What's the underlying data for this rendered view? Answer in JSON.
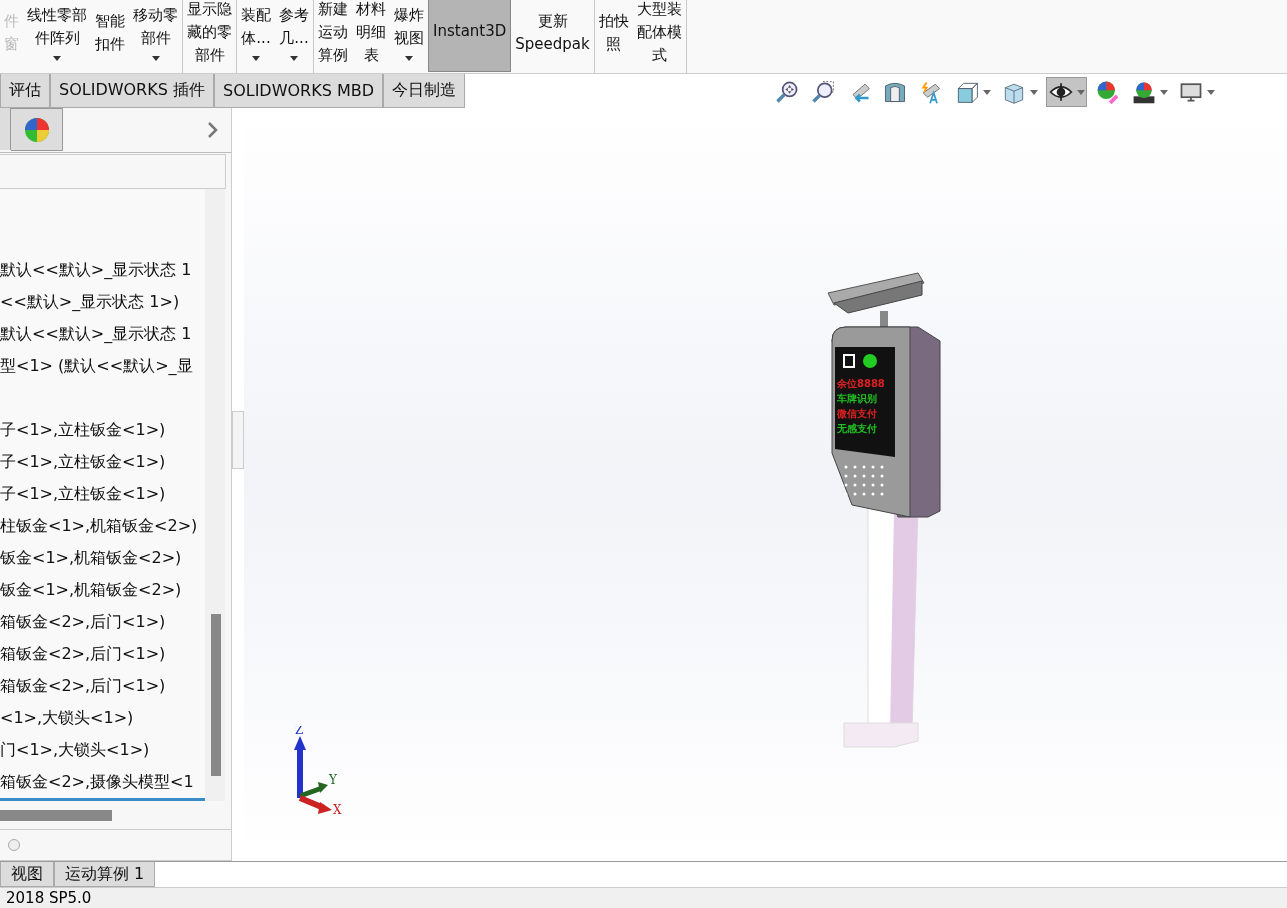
{
  "toolbar": {
    "items": [
      {
        "lines": [
          "件",
          "窗"
        ],
        "caret": false,
        "selected": false,
        "disabled": true,
        "group_end": false
      },
      {
        "lines": [
          "线性零部",
          "件阵列"
        ],
        "caret": true,
        "selected": false,
        "disabled": false,
        "group_end": false
      },
      {
        "lines": [
          "智能",
          "扣件"
        ],
        "caret": false,
        "selected": false,
        "disabled": false,
        "group_end": false
      },
      {
        "lines": [
          "移动零",
          "部件"
        ],
        "caret": true,
        "selected": false,
        "disabled": false,
        "group_end": true
      },
      {
        "lines": [
          "显示隐",
          "藏的零",
          "部件"
        ],
        "caret": false,
        "selected": false,
        "disabled": false,
        "group_end": true
      },
      {
        "lines": [
          "装配",
          "体..."
        ],
        "caret": true,
        "selected": false,
        "disabled": false,
        "group_end": false
      },
      {
        "lines": [
          "参考",
          "几..."
        ],
        "caret": true,
        "selected": false,
        "disabled": false,
        "group_end": true
      },
      {
        "lines": [
          "新建",
          "运动",
          "算例"
        ],
        "caret": false,
        "selected": false,
        "disabled": false,
        "group_end": false
      },
      {
        "lines": [
          "材料",
          "明细",
          "表"
        ],
        "caret": false,
        "selected": false,
        "disabled": false,
        "group_end": false
      },
      {
        "lines": [
          "爆炸",
          "视图"
        ],
        "caret": true,
        "selected": false,
        "disabled": false,
        "group_end": false
      },
      {
        "lines": [
          "Instant3D"
        ],
        "caret": false,
        "selected": true,
        "disabled": false,
        "group_end": false
      },
      {
        "lines": [
          "更新",
          "Speedpak"
        ],
        "caret": false,
        "selected": false,
        "disabled": false,
        "group_end": true
      },
      {
        "lines": [
          "拍快",
          "照"
        ],
        "caret": false,
        "selected": false,
        "disabled": false,
        "group_end": false
      },
      {
        "lines": [
          "大型装",
          "配体模",
          "式"
        ],
        "caret": false,
        "selected": false,
        "disabled": false,
        "group_end": true
      }
    ]
  },
  "command_tabs": [
    {
      "label": "评估",
      "selected": false
    },
    {
      "label": "SOLIDWORKS 插件",
      "selected": false
    },
    {
      "label": "SOLIDWORKS MBD",
      "selected": false
    },
    {
      "label": "今日制造",
      "selected": false
    }
  ],
  "view_tools": [
    {
      "kind": "zoom-fit",
      "dropdown": false,
      "selected": false
    },
    {
      "kind": "zoom-area",
      "dropdown": false,
      "selected": false
    },
    {
      "kind": "previous-view",
      "dropdown": false,
      "selected": false
    },
    {
      "kind": "section-view",
      "dropdown": false,
      "selected": false
    },
    {
      "kind": "dynamic-annotation",
      "dropdown": false,
      "selected": false
    },
    {
      "kind": "view-orientation",
      "dropdown": true,
      "selected": false
    },
    {
      "kind": "display-style",
      "dropdown": true,
      "selected": false
    },
    {
      "kind": "hide-show",
      "dropdown": true,
      "selected": true
    },
    {
      "kind": "edit-appearance",
      "dropdown": false,
      "selected": false
    },
    {
      "kind": "apply-scene",
      "dropdown": true,
      "selected": false
    },
    {
      "kind": "view-settings",
      "dropdown": true,
      "selected": false
    }
  ],
  "feature_tree": {
    "groups": [
      {
        "rows": [
          "默认<<默认>_显示状态 1",
          "<<默认>_显示状态 1>)",
          "默认<<默认>_显示状态 1",
          "型<1> (默认<<默认>_显"
        ]
      },
      {
        "rows": [
          "子<1>,立柱钣金<1>)",
          "子<1>,立柱钣金<1>)",
          "子<1>,立柱钣金<1>)",
          "柱钣金<1>,机箱钣金<2>)",
          "钣金<1>,机箱钣金<2>)",
          "钣金<1>,机箱钣金<2>)",
          "箱钣金<2>,后门<1>)",
          "箱钣金<2>,后门<1>)",
          "箱钣金<2>,后门<1>)",
          "<1>,大锁头<1>)",
          "门<1>,大锁头<1>)",
          "箱钣金<2>,摄像头模型<1"
        ]
      }
    ]
  },
  "model": {
    "display_lines": [
      {
        "text": "余位8888",
        "color": "#e02020"
      },
      {
        "text": "车牌识别",
        "color": "#20c020"
      },
      {
        "text": "微信支付",
        "color": "#e02020"
      },
      {
        "text": "无感支付",
        "color": "#20c020"
      }
    ]
  },
  "triad": {
    "x_label": "X",
    "y_label": "Y",
    "z_label": "Z"
  },
  "panel_option": {
    "selected": false
  },
  "bottom_tabs": [
    {
      "label": "视图",
      "selected": false
    },
    {
      "label": "运动算例 1",
      "selected": false
    }
  ],
  "status_bar": {
    "text": "2018 SP5.0"
  }
}
